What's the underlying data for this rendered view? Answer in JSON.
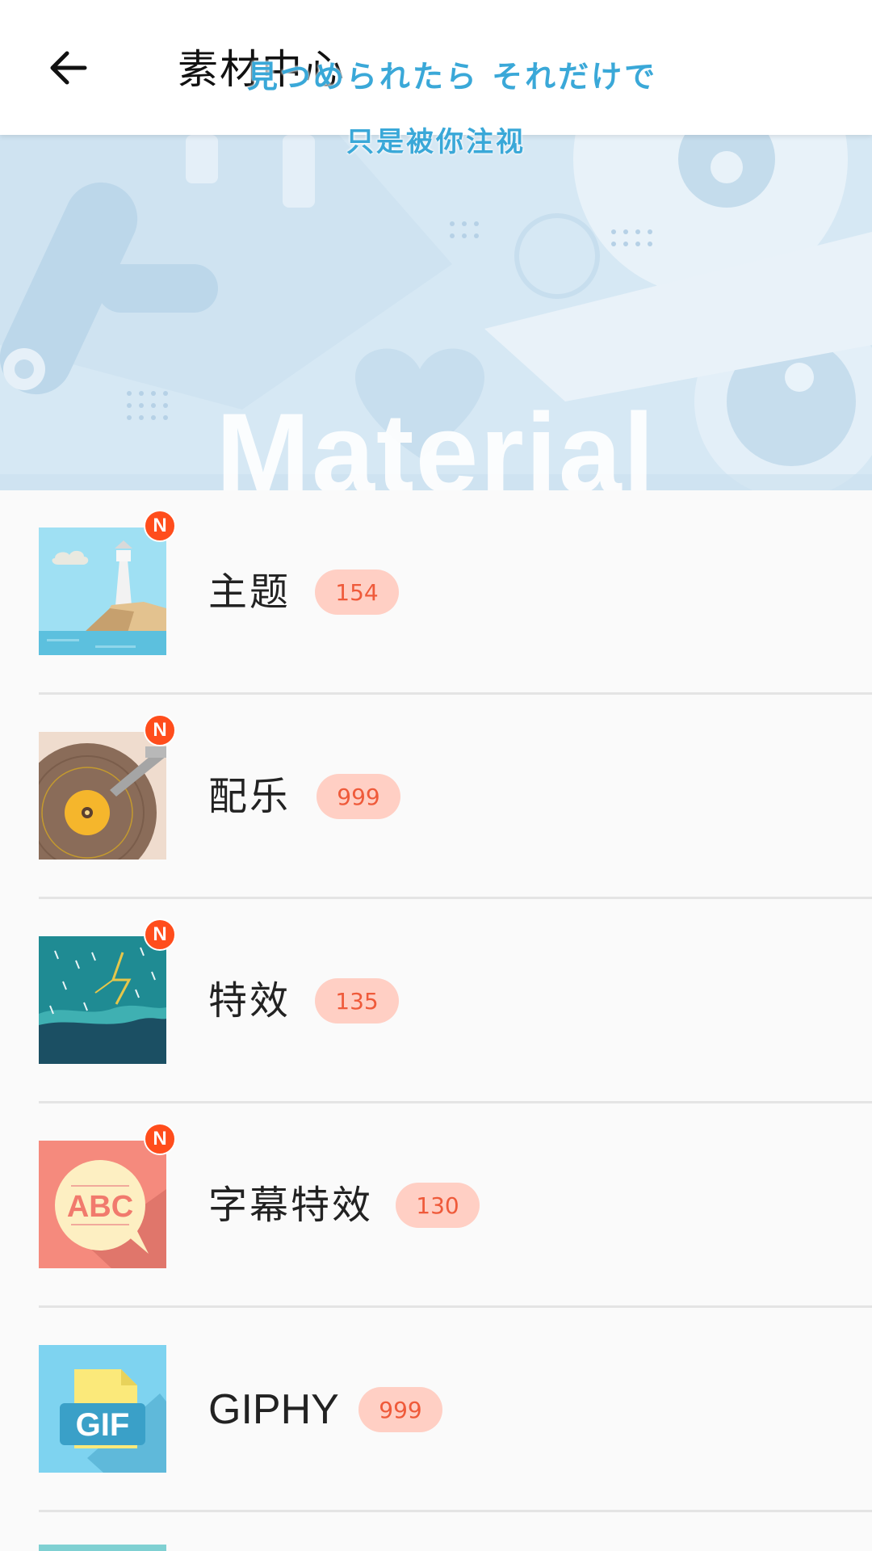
{
  "header": {
    "title": "素材中心",
    "back_icon": "arrow-left-icon"
  },
  "lyrics": {
    "line1": "見つめられたら それだけで",
    "line2": "只是被你注视"
  },
  "banner": {
    "text": "Material"
  },
  "list": {
    "items": [
      {
        "label": "主题",
        "count": "154",
        "badge": "N",
        "icon": "lighthouse-icon"
      },
      {
        "label": "配乐",
        "count": "999",
        "badge": "N",
        "icon": "vinyl-record-icon"
      },
      {
        "label": "特效",
        "count": "135",
        "badge": "N",
        "icon": "lightning-rain-icon"
      },
      {
        "label": "字幕特效",
        "count": "130",
        "badge": "N",
        "icon": "abc-speech-bubble-icon"
      },
      {
        "label": "GIPHY",
        "count": "999",
        "badge": "",
        "icon": "gif-file-icon"
      }
    ]
  },
  "colors": {
    "accent_badge": "#ff4d1c",
    "count_pill_bg": "#ffcfc4",
    "count_pill_text": "#ef5a3a",
    "lyric_text": "#3aa8d8"
  }
}
